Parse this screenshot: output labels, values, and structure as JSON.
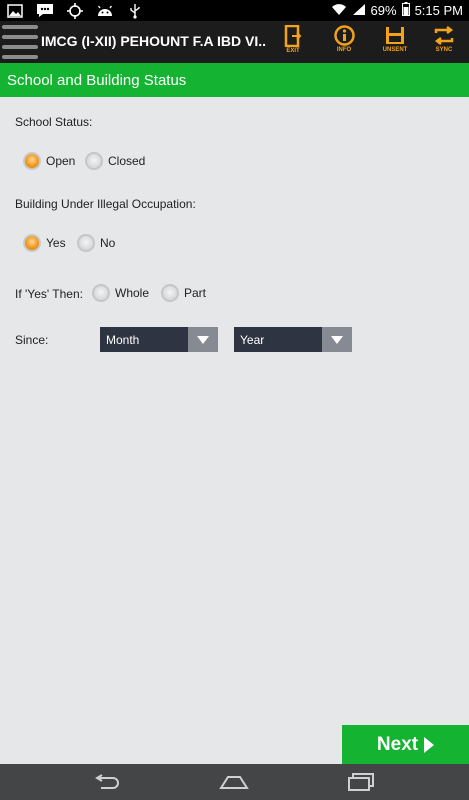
{
  "status_bar": {
    "battery": "69%",
    "time": "5:15 PM",
    "icons": [
      "image-icon",
      "chat-icon",
      "gps-icon",
      "android-icon",
      "usb-icon",
      "wifi-icon",
      "signal-icon",
      "battery-icon"
    ]
  },
  "action_bar": {
    "title": "IMCG (I-XII) PEHOUNT F.A IBD VI...",
    "actions": [
      {
        "label": "EXIT",
        "icon": "exit-icon"
      },
      {
        "label": "INFO",
        "icon": "info-icon"
      },
      {
        "label": "UNSENT",
        "icon": "unsent-icon"
      },
      {
        "label": "SYNC",
        "icon": "sync-icon"
      }
    ],
    "accent": "#f5a21b"
  },
  "section": {
    "title": "School and Building Status",
    "color": "#14b432"
  },
  "form": {
    "school_status": {
      "label": "School Status:",
      "options": [
        "Open",
        "Closed"
      ],
      "selected": "Open"
    },
    "illegal_occupation": {
      "label": "Building Under Illegal Occupation:",
      "options": [
        "Yes",
        "No"
      ],
      "selected": "Yes"
    },
    "if_yes": {
      "label": "If 'Yes' Then:",
      "options": [
        "Whole",
        "Part"
      ],
      "selected": null
    },
    "since": {
      "label": "Since:",
      "month": "Month",
      "year": "Year"
    }
  },
  "footer": {
    "next_label": "Next"
  },
  "nav_bar": {
    "icons": [
      "back-icon",
      "home-icon",
      "recents-icon"
    ]
  }
}
